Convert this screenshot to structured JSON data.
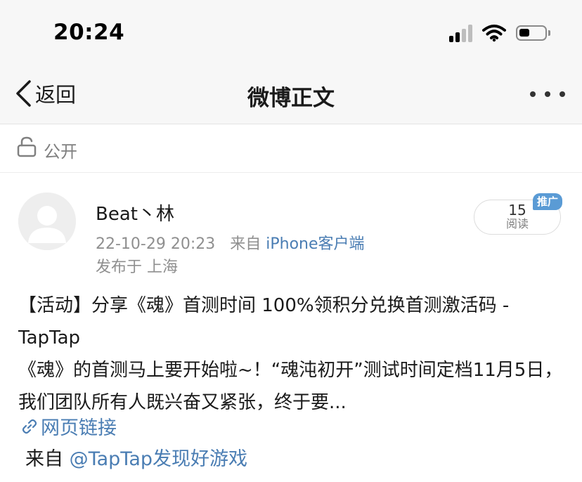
{
  "status_bar": {
    "time": "20:24"
  },
  "nav": {
    "back_label": "返回",
    "title": "微博正文"
  },
  "visibility": {
    "label": "公开"
  },
  "post": {
    "author": "Beat丶林",
    "timestamp": "22-10-29 20:23",
    "source_prefix": "来自",
    "source": "iPhone客户端",
    "location": "发布于 上海",
    "read_count": "15",
    "read_label": "阅读",
    "promote_badge": "推广",
    "title_line": "【活动】分享《魂》首测时间 100%领积分兑换首测激活码 - TapTap",
    "body_text": "《魂》的首测马上要开始啦~！“魂沌初开”测试时间定档11月5日，我们团队所有人既兴奋又紧张，终于要...",
    "link_label": "网页链接",
    "from_prefix": "来自",
    "from_mention": "@TapTap发现好游戏"
  }
}
